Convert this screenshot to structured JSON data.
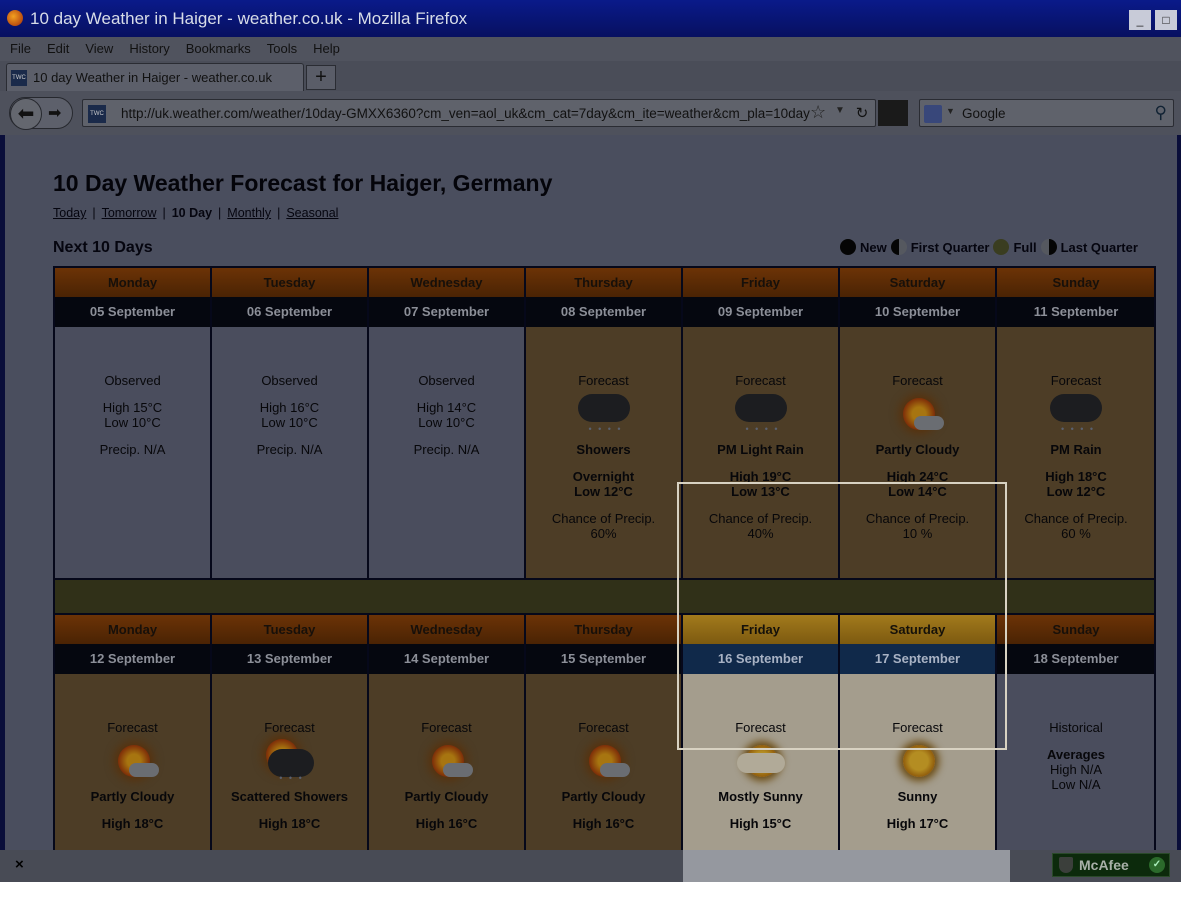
{
  "window": {
    "title": "10 day Weather in Haiger - weather.co.uk - Mozilla Firefox",
    "min": "_",
    "close": "□"
  },
  "menu": [
    "File",
    "Edit",
    "View",
    "History",
    "Bookmarks",
    "Tools",
    "Help"
  ],
  "tab": {
    "label": "10 day Weather in Haiger - weather.co.uk",
    "favicon": "TWC",
    "new_tab": "+"
  },
  "nav": {
    "url": "http://uk.weather.com/weather/10day-GMXX6360?cm_ven=aol_uk&cm_cat=7day&cm_ite=weather&cm_pla=10day",
    "url_favicon": "TWC",
    "search_placeholder": "Google"
  },
  "page": {
    "title": "10 Day Weather Forecast for Haiger, Germany",
    "subnav": {
      "today": "Today",
      "tomorrow": "Tomorrow",
      "tenday": "10 Day",
      "monthly": "Monthly",
      "seasonal": "Seasonal",
      "sep": "|"
    },
    "section": "Next 10 Days",
    "moon": {
      "new": "New",
      "first": "First Quarter",
      "full": "Full",
      "last": "Last Quarter"
    }
  },
  "week1": {
    "days": [
      "Monday",
      "Tuesday",
      "Wednesday",
      "Thursday",
      "Friday",
      "Saturday",
      "Sunday"
    ],
    "dates": [
      "05 September",
      "06 September",
      "07 September",
      "08 September",
      "09 September",
      "10 September",
      "11 September"
    ],
    "cells": [
      {
        "label": "Observed",
        "high": "High 15°C",
        "low": "Low 10°C",
        "precip": "Precip. N/A"
      },
      {
        "label": "Observed",
        "high": "High 16°C",
        "low": "Low 10°C",
        "precip": "Precip. N/A"
      },
      {
        "label": "Observed",
        "high": "High 14°C",
        "low": "Low 10°C",
        "precip": "Precip. N/A"
      },
      {
        "label": "Forecast",
        "cond": "Showers",
        "high": "Overnight",
        "low": "Low 12°C",
        "chance": "Chance of Precip.",
        "pct": "60%",
        "icon": "rain-cloud-icon"
      },
      {
        "label": "Forecast",
        "cond": "PM Light Rain",
        "high": "High 19°C",
        "low": "Low 13°C",
        "chance": "Chance of Precip.",
        "pct": "40%",
        "icon": "rain-cloud-icon"
      },
      {
        "label": "Forecast",
        "cond": "Partly Cloudy",
        "high": "High 24°C",
        "low": "Low 14°C",
        "chance": "Chance of Precip.",
        "pct": "10 %",
        "icon": "partly-cloudy-icon"
      },
      {
        "label": "Forecast",
        "cond": "PM Rain",
        "high": "High 18°C",
        "low": "Low 12°C",
        "chance": "Chance of Precip.",
        "pct": "60 %",
        "icon": "rain-cloud-icon"
      }
    ]
  },
  "week2": {
    "days": [
      "Monday",
      "Tuesday",
      "Wednesday",
      "Thursday",
      "Friday",
      "Saturday",
      "Sunday"
    ],
    "dates": [
      "12 September",
      "13 September",
      "14 September",
      "15 September",
      "16 September",
      "17 September",
      "18 September"
    ],
    "cells": [
      {
        "label": "Forecast",
        "cond": "Partly Cloudy",
        "high": "High 18°C",
        "icon": "partly-cloudy-icon"
      },
      {
        "label": "Forecast",
        "cond": "Scattered Showers",
        "high": "High 18°C",
        "icon": "scattered-showers-icon"
      },
      {
        "label": "Forecast",
        "cond": "Partly Cloudy",
        "high": "High 16°C",
        "icon": "partly-cloudy-icon"
      },
      {
        "label": "Forecast",
        "cond": "Partly Cloudy",
        "high": "High 16°C",
        "icon": "partly-cloudy-icon"
      },
      {
        "label": "Forecast",
        "cond": "Mostly Sunny",
        "high": "High 15°C",
        "icon": "mostly-sunny-icon"
      },
      {
        "label": "Forecast",
        "cond": "Sunny",
        "high": "High 17°C",
        "icon": "sunny-icon"
      },
      {
        "label": "Historical",
        "cond": "Averages",
        "high": "High N/A",
        "low": "Low N/A"
      }
    ]
  },
  "status": {
    "close": "×",
    "mcafee": "McAfee",
    "mcafee_check": "✓"
  }
}
